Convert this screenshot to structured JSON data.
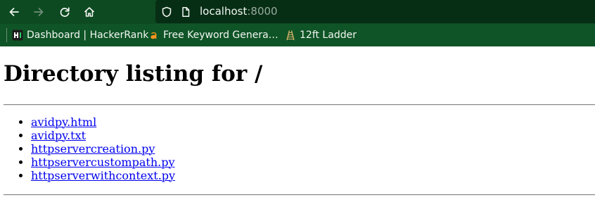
{
  "browser": {
    "url_host": "localhost",
    "url_port": ":8000",
    "bookmarks": [
      {
        "label": "Dashboard | HackerRank",
        "icon": "hackerrank-icon"
      },
      {
        "label": "Free Keyword Genera…",
        "icon": "ahrefs-icon"
      },
      {
        "label": "12ft Ladder",
        "icon": "ladder-icon"
      }
    ]
  },
  "page": {
    "heading": "Directory listing for /",
    "files": [
      "avidpy.html",
      "avidpy.txt",
      "httpservercreation.py",
      "httpservercustompath.py",
      "httpserverwithcontext.py"
    ]
  },
  "colors": {
    "toolbar": "#0d4a21",
    "urlbar": "#062e14",
    "bookmarks_bar": "#0f5426",
    "link": "#0000ee"
  }
}
